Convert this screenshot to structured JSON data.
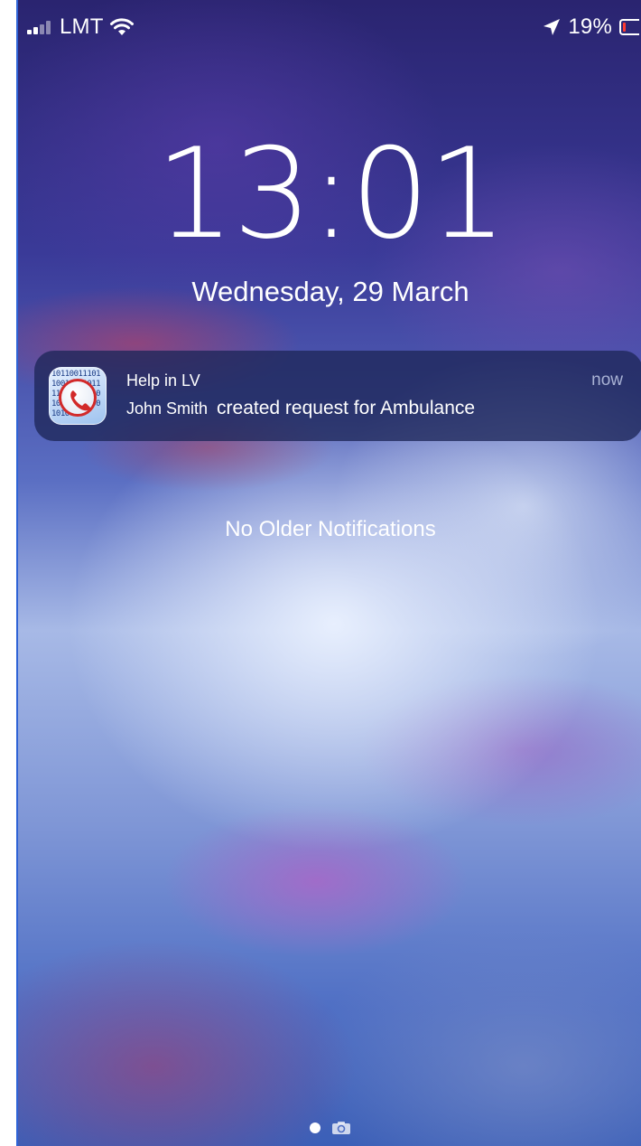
{
  "status_bar": {
    "carrier": "LMT",
    "battery_percent": "19%",
    "battery_level": 0.19,
    "signal_bars_active": 2,
    "signal_bars_total": 4,
    "icons": [
      "signal-icon",
      "wifi-icon",
      "location-arrow-icon",
      "battery-icon"
    ]
  },
  "lock_screen": {
    "time": "13:01",
    "date": "Wednesday, 29 March"
  },
  "notification": {
    "app_name": "Help in LV",
    "time": "now",
    "sender": "John Smith",
    "message": "created request for Ambulance",
    "icon": "help-in-lv-app-icon",
    "icon_text": "101100111011001101101111011001010101110110001010"
  },
  "no_older_notifications": "No Older Notifications",
  "page_indicator": {
    "icons": [
      "page-dot",
      "camera-icon"
    ]
  },
  "colors": {
    "battery_low": "#ff3b30",
    "notification_bg": "#1e2658",
    "notification_time": "#a9b2d4",
    "frame_accent": "#2f63d6"
  }
}
